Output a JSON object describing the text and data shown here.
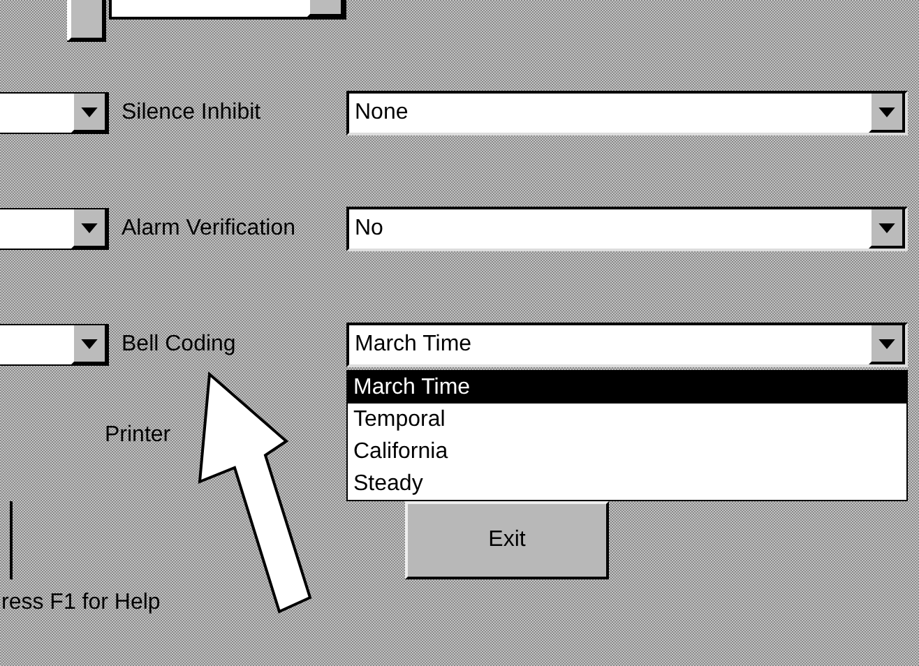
{
  "rows": [
    {
      "label": "Silence Inhibit",
      "value": "None"
    },
    {
      "label": "Alarm Verification",
      "value": "No"
    },
    {
      "label": "Bell Coding",
      "value": "March Time",
      "options": [
        {
          "label": "March Time",
          "selected": true
        },
        {
          "label": "Temporal",
          "selected": false
        },
        {
          "label": "California",
          "selected": false
        },
        {
          "label": "Steady",
          "selected": false
        }
      ]
    }
  ],
  "printer_label": "Printer",
  "exit_button": "Exit",
  "status_text": "ress F1 for Help"
}
